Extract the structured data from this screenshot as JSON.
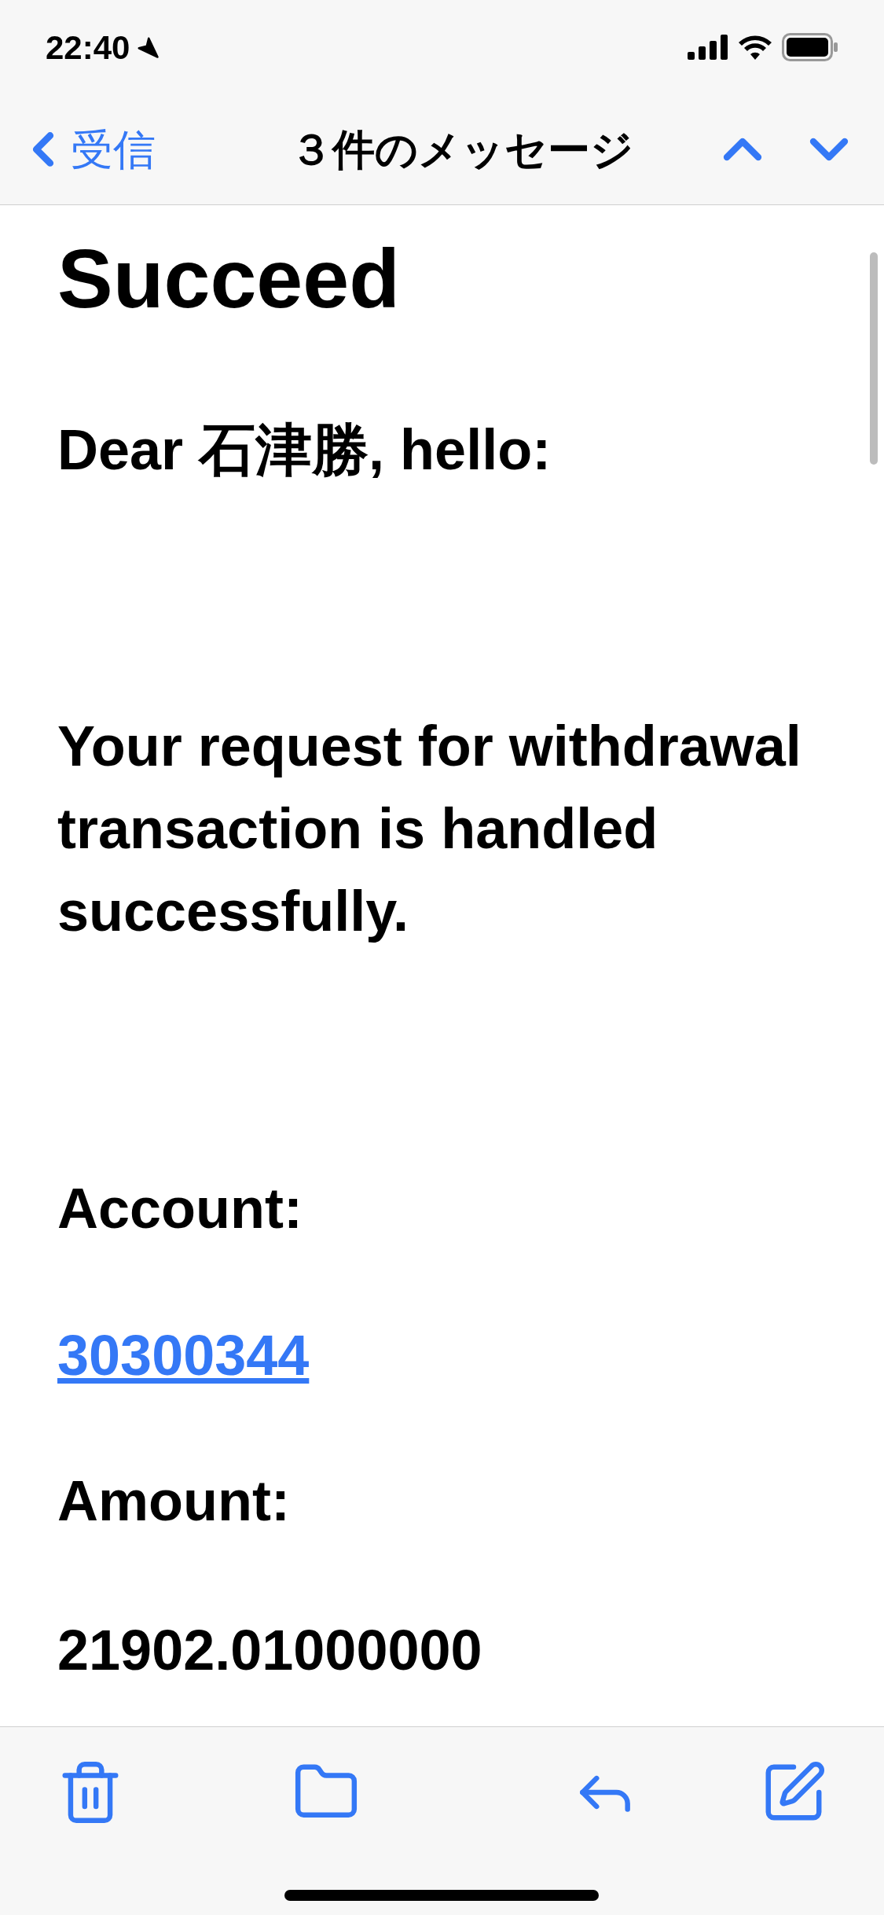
{
  "status_bar": {
    "time": "22:40"
  },
  "nav": {
    "back_label": "受信",
    "title": "３件のメッセージ"
  },
  "message": {
    "subject": "Succeed",
    "greeting": "Dear 石津勝, hello:",
    "body": "Your request for withdrawal transaction is handled successfully.",
    "fields": [
      {
        "label": "Account:",
        "value": "30300344",
        "kind": "link"
      },
      {
        "label": "Amount:",
        "value": "21902.01000000",
        "kind": "text"
      }
    ]
  }
}
